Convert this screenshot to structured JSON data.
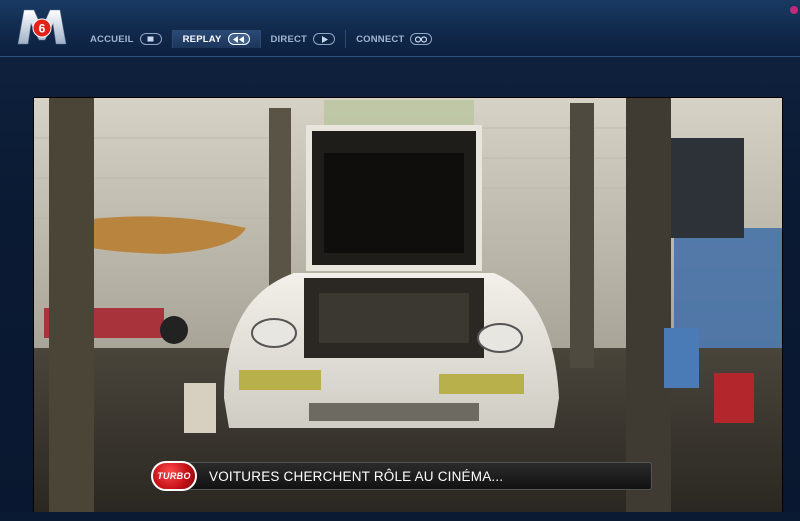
{
  "header": {
    "brand": "M6",
    "nav": [
      {
        "label": "ACCUEIL",
        "icon": "stop-square-icon",
        "active": false
      },
      {
        "label": "REPLAY",
        "icon": "rewind-icon",
        "active": true
      },
      {
        "label": "DIRECT",
        "icon": "play-icon",
        "active": false
      },
      {
        "label": "CONNECT",
        "icon": "chain-link-icon",
        "active": false
      }
    ]
  },
  "video": {
    "show_logo": "TURBO",
    "caption": "VOITURES CHERCHENT RÔLE AU CINÉMA..."
  },
  "colors": {
    "brand_red": "#e2231a",
    "nav_active": "#ffffff",
    "nav_inactive": "#9fb5d3",
    "background": "#0b1a33"
  }
}
